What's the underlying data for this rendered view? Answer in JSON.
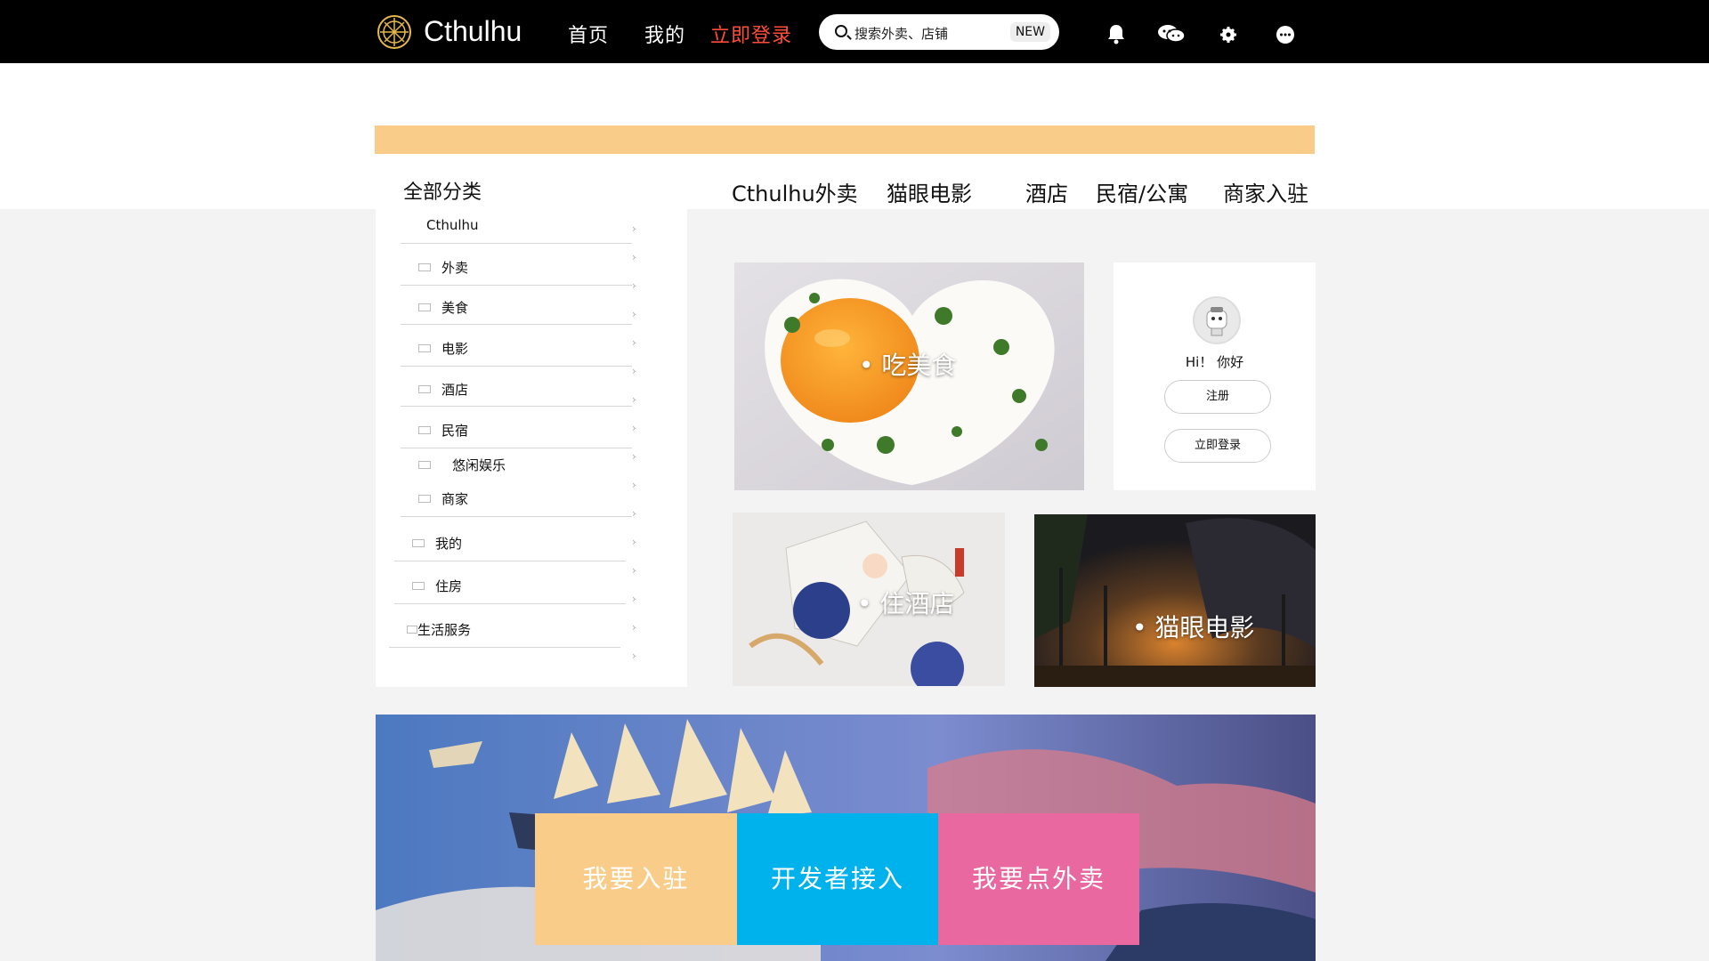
{
  "header": {
    "brand": "Cthulhu",
    "nav": [
      "首页",
      "我的",
      "立即登录"
    ],
    "search_placeholder": "搜索外卖、店铺",
    "search_badge": "NEW",
    "icons": [
      "bell-icon",
      "chat-icon",
      "gear-icon",
      "more-icon"
    ]
  },
  "sidebar": {
    "title": "全部分类",
    "items": [
      "Cthulhu",
      "外卖",
      "美食",
      "电影",
      "酒店",
      "民宿",
      "悠闲娱乐",
      "商家",
      "我的",
      "住房",
      "生活服务"
    ]
  },
  "categories": [
    "Cthulhu外卖",
    "猫眼电影",
    "酒店",
    "民宿/公寓",
    "商家入驻"
  ],
  "tiles": {
    "food": "• 吃美食",
    "hotel": "• 住酒店",
    "movie": "• 猫眼电影"
  },
  "profile": {
    "greeting": "Hi！ 你好",
    "register": "注册",
    "login": "立即登录"
  },
  "cta": [
    "我要入驻",
    "开发者接入",
    "我要点外卖"
  ],
  "colors": {
    "banner": "#f9cd89",
    "cta_orange": "#f9cd89",
    "cta_blue": "#00b2ec",
    "cta_pink": "#e8689f",
    "login_red": "#ff4d3a"
  }
}
